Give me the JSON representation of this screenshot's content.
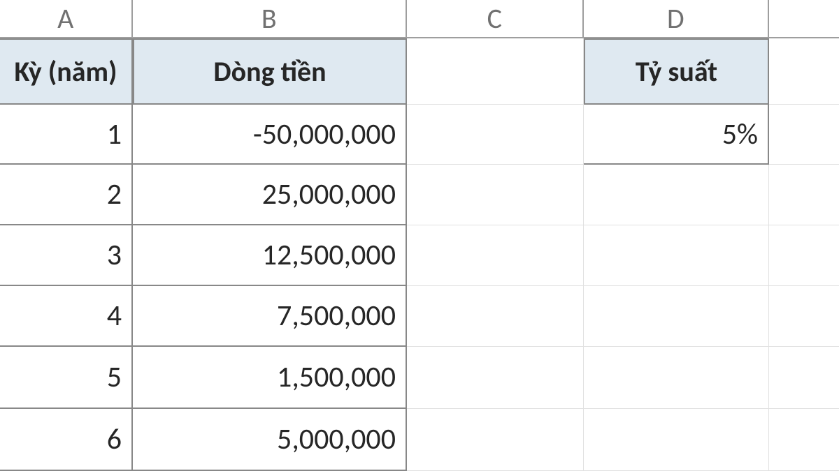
{
  "columns": {
    "A": "A",
    "B": "B",
    "C": "C",
    "D": "D"
  },
  "headers": {
    "A": "Kỳ (năm)",
    "B": "Dòng tiền",
    "D": "Tỷ suất"
  },
  "rows": [
    {
      "period": "1",
      "cashflow": "-50,000,000"
    },
    {
      "period": "2",
      "cashflow": "25,000,000"
    },
    {
      "period": "3",
      "cashflow": "12,500,000"
    },
    {
      "period": "4",
      "cashflow": "7,500,000"
    },
    {
      "period": "5",
      "cashflow": "1,500,000"
    },
    {
      "period": "6",
      "cashflow": "5,000,000"
    }
  ],
  "rate": "5%"
}
